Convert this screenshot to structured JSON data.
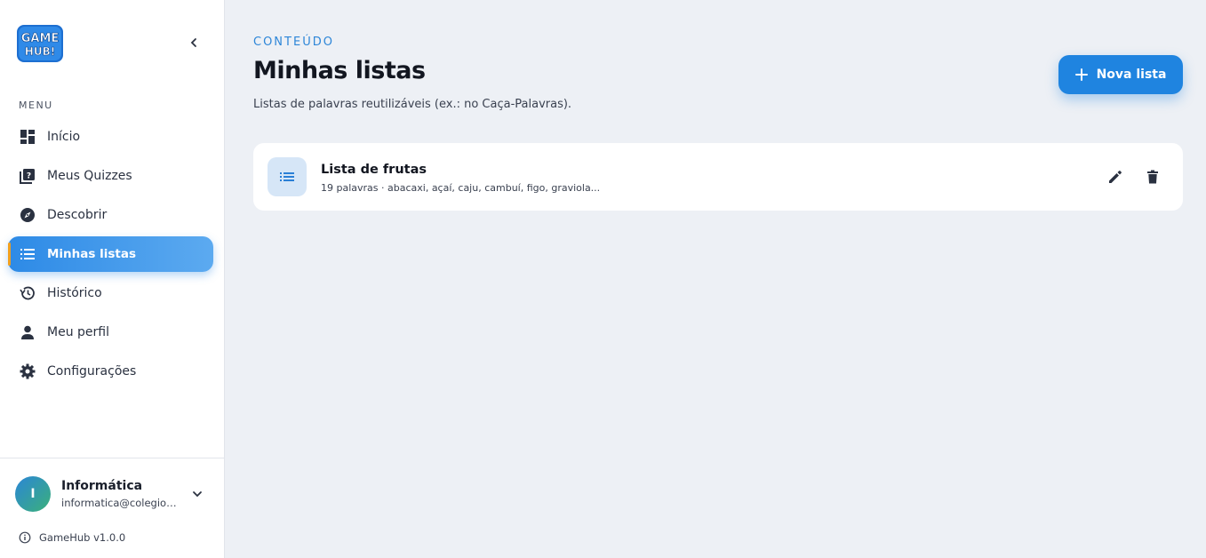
{
  "brand": {
    "logo_text": "GAME HUB!"
  },
  "sidebar": {
    "menu_label": "MENU",
    "items": [
      {
        "label": "Início",
        "icon": "dashboard-icon",
        "active": false
      },
      {
        "label": "Meus Quizzes",
        "icon": "quiz-icon",
        "active": false
      },
      {
        "label": "Descobrir",
        "icon": "compass-icon",
        "active": false
      },
      {
        "label": "Minhas listas",
        "icon": "list-icon",
        "active": true
      },
      {
        "label": "Histórico",
        "icon": "history-icon",
        "active": false
      },
      {
        "label": "Meu perfil",
        "icon": "person-icon",
        "active": false
      },
      {
        "label": "Configurações",
        "icon": "gear-icon",
        "active": false
      }
    ],
    "user": {
      "initial": "I",
      "name": "Informática",
      "email": "informatica@colegiosa..."
    },
    "version": "GameHub v1.0.0"
  },
  "main": {
    "eyebrow": "CONTEÚDO",
    "title": "Minhas listas",
    "subtitle": "Listas de palavras reutilizáveis (ex.: no Caça-Palavras).",
    "new_button": "Nova lista",
    "lists": [
      {
        "title": "Lista de frutas",
        "meta": "19 palavras · abacaxi, açaí, caju, cambuí, figo, graviola..."
      }
    ]
  },
  "colors": {
    "accent": "#1f84e0",
    "active_marker": "#f0a020",
    "background": "#edf0f5"
  }
}
